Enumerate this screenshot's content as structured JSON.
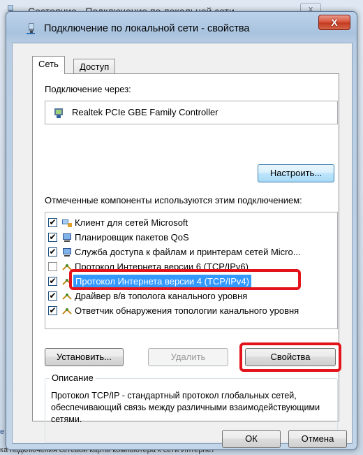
{
  "background_window": {
    "title": "Состояние - Подключение по локальной сети",
    "close_label": "ⅹ",
    "left_edge_text": "е н",
    "bottom_text": "ка подключения сетевой карты компьютера к сети Интернет"
  },
  "dialog": {
    "title": "Подключение по локальной сети - свойства",
    "close_label": "X",
    "tabs": [
      {
        "label": "Сеть",
        "active": true
      },
      {
        "label": "Доступ",
        "active": false
      }
    ],
    "connect_via_label": "Подключение через:",
    "adapter_name": "Realtek PCIe GBE Family Controller",
    "configure_button": "Настроить...",
    "components_label": "Отмеченные компоненты используются этим подключением:",
    "components": [
      {
        "label": "Клиент для сетей Microsoft",
        "checked": true,
        "icon": "network-client-icon"
      },
      {
        "label": "Планировщик пакетов QoS",
        "checked": true,
        "icon": "computer-icon"
      },
      {
        "label": "Служба доступа к файлам и принтерам сетей Micro...",
        "checked": true,
        "icon": "computer-icon"
      },
      {
        "label": "Протокол Интернета версии 6 (TCP/IPv6)",
        "checked": false,
        "icon": "protocol-icon"
      },
      {
        "label": "Протокол Интернета версии 4 (TCP/IPv4)",
        "checked": true,
        "icon": "protocol-icon",
        "selected": true
      },
      {
        "label": "Драйвер в/в тополога канального уровня",
        "checked": true,
        "icon": "protocol-icon"
      },
      {
        "label": "Ответчик обнаружения топологии канального уровня",
        "checked": true,
        "icon": "protocol-icon"
      }
    ],
    "install_button": "Установить...",
    "uninstall_button": "Удалить",
    "properties_button": "Свойства",
    "description_legend": "Описание",
    "description_text": "Протокол TCP/IP - стандартный протокол глобальных сетей, обеспечивающий связь между различными взаимодействующими сетями.",
    "ok_button": "ОК",
    "cancel_button": "Отмена"
  },
  "colors": {
    "highlight_red": "#e3131b",
    "selection_blue": "#3399ff"
  }
}
